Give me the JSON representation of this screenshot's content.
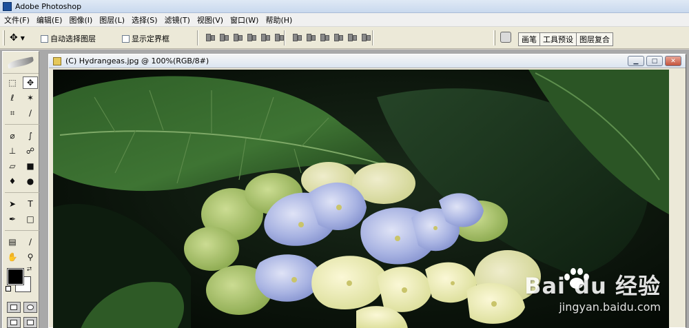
{
  "app": {
    "title": "Adobe Photoshop"
  },
  "menu": [
    "文件(F)",
    "编辑(E)",
    "图像(I)",
    "图层(L)",
    "选择(S)",
    "滤镜(T)",
    "视图(V)",
    "窗口(W)",
    "帮助(H)"
  ],
  "options": {
    "auto_select_label": "自动选择图层",
    "show_bounds_label": "显示定界框",
    "panel_tabs": [
      "画笔",
      "工具预设",
      "图层复合"
    ]
  },
  "document": {
    "title": "(C) Hydrangeas.jpg @ 100%(RGB/8#)",
    "window_buttons": [
      "minimize-icon",
      "maximize-icon",
      "close-icon"
    ]
  },
  "watermark": {
    "brand": "Bai du 经验",
    "url": "jingyan.baidu.com"
  },
  "colors": {
    "foreground": "#000000",
    "background": "#ffffff"
  }
}
